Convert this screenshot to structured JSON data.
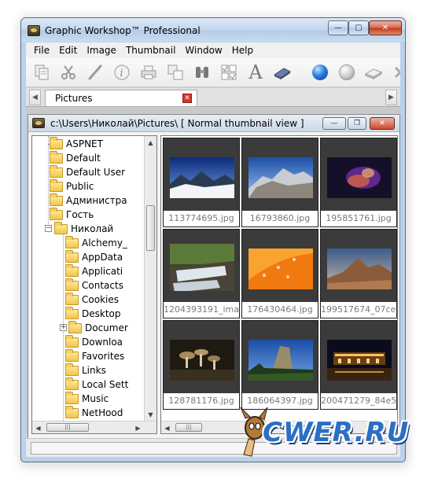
{
  "window": {
    "title": "Graphic Workshop™ Professional"
  },
  "window_controls": {
    "minimize": "—",
    "maximize": "▢",
    "close": "✕"
  },
  "menu": [
    "File",
    "Edit",
    "Image",
    "Thumbnail",
    "Window",
    "Help"
  ],
  "toolbar": {
    "icons": [
      "copy-pages-icon",
      "scissors-icon",
      "brush-icon",
      "info-icon",
      "printer-icon",
      "duplicate-icon",
      "binoculars-icon",
      "checklist-icon",
      "text-tool-icon",
      "scanner-icon",
      "blue-ball-icon",
      "grey-ball-icon",
      "eraser-icon",
      "close-x-icon"
    ],
    "text_tool_glyph": "A"
  },
  "tabs": [
    {
      "label": "Pictures",
      "close_glyph": "✕"
    }
  ],
  "tab_scroll": {
    "left": "◀",
    "right": "▶"
  },
  "child_window": {
    "path": "c:\\Users\\Николай\\Pictures\\ [ Normal thumbnail view ]",
    "controls": {
      "minimize": "—",
      "restore": "❐",
      "close": "✕"
    }
  },
  "tree": {
    "items": [
      {
        "label": "ASPNET",
        "level": 1
      },
      {
        "label": "Default",
        "level": 1
      },
      {
        "label": "Default User",
        "level": 1
      },
      {
        "label": "Public",
        "level": 1
      },
      {
        "label": "Администра",
        "level": 1
      },
      {
        "label": "Гость",
        "level": 1
      },
      {
        "label": "Николай",
        "level": 1,
        "expander": "−"
      },
      {
        "label": "Alchemy_",
        "level": 2
      },
      {
        "label": "AppData",
        "level": 2
      },
      {
        "label": "Applicati",
        "level": 2
      },
      {
        "label": "Contacts",
        "level": 2
      },
      {
        "label": "Cookies",
        "level": 2
      },
      {
        "label": "Desktop",
        "level": 2
      },
      {
        "label": "Documer",
        "level": 2,
        "expander": "+"
      },
      {
        "label": "Downloa",
        "level": 2
      },
      {
        "label": "Favorites",
        "level": 2
      },
      {
        "label": "Links",
        "level": 2
      },
      {
        "label": "Local Sett",
        "level": 2
      },
      {
        "label": "Music",
        "level": 2
      },
      {
        "label": "NetHood",
        "level": 2
      }
    ]
  },
  "scroll_glyphs": {
    "up": "▲",
    "down": "▼",
    "left": "◀",
    "right": "▶",
    "grip": "|||"
  },
  "thumbnails": [
    {
      "filename": "113774695.jpg"
    },
    {
      "filename": "16793860.jpg"
    },
    {
      "filename": "195851761.jpg"
    },
    {
      "filename": "1204393191_ima..."
    },
    {
      "filename": "176430464.jpg"
    },
    {
      "filename": "199517674_07ce..."
    },
    {
      "filename": "128781176.jpg"
    },
    {
      "filename": "186064397.jpg"
    },
    {
      "filename": "200471279_84e5..."
    }
  ],
  "status": {
    "text": ""
  },
  "watermark": {
    "text": "CWER.RU"
  }
}
